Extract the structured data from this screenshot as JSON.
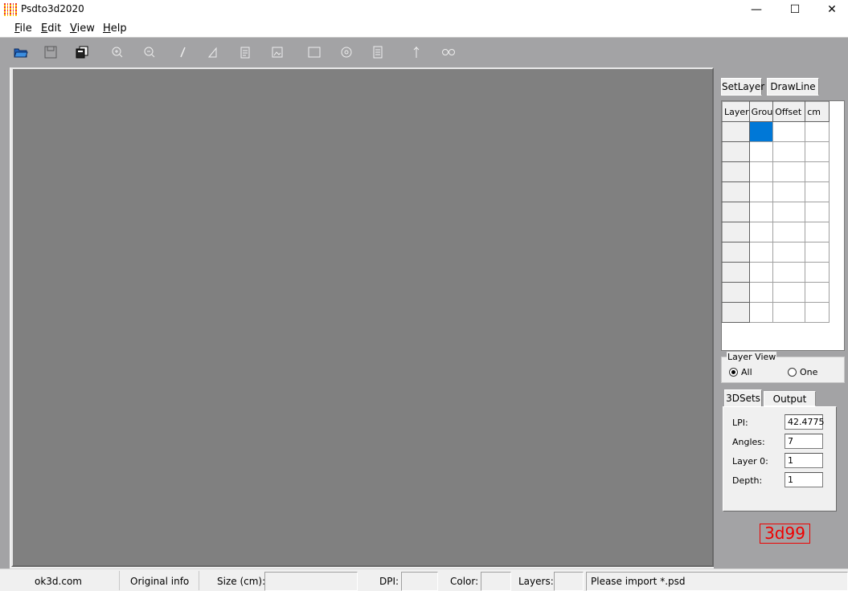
{
  "window": {
    "title": "Psdto3d2020"
  },
  "window_controls": {
    "minimize": "—",
    "maximize": "☐",
    "close": "✕"
  },
  "menu": [
    {
      "label": "File",
      "mnemonic": "F",
      "rest": "ile"
    },
    {
      "label": "Edit",
      "mnemonic": "E",
      "rest": "dit"
    },
    {
      "label": "View",
      "mnemonic": "V",
      "rest": "iew"
    },
    {
      "label": "Help",
      "mnemonic": "H",
      "rest": "elp"
    }
  ],
  "toolbar": [
    {
      "icon": "open-folder-icon"
    },
    {
      "icon": "save-icon"
    },
    {
      "icon": "copy-pages-icon"
    },
    {
      "icon": "zoom-in-icon"
    },
    {
      "icon": "zoom-out-icon"
    },
    {
      "icon": "pen-icon"
    },
    {
      "icon": "triangle-tool-icon"
    },
    {
      "icon": "page-edit-icon"
    },
    {
      "icon": "image-edit-icon"
    },
    {
      "icon": "rectangle-icon"
    },
    {
      "icon": "target-icon"
    },
    {
      "icon": "document-icon"
    },
    {
      "icon": "split-icon"
    },
    {
      "icon": "link-circles-icon"
    }
  ],
  "side_tabs": {
    "set_layer": "SetLayer",
    "draw_line": "DrawLine"
  },
  "layer_grid": {
    "columns": [
      "Layer",
      "Grou",
      "Offset",
      "cm"
    ],
    "row_count": 10,
    "selected_cell": {
      "row": 0,
      "col": 1
    }
  },
  "layer_view": {
    "legend": "Layer View",
    "options": [
      {
        "label": "All",
        "checked": true
      },
      {
        "label": "One",
        "checked": false
      }
    ]
  },
  "sets_tabs": {
    "sets_3d": "3DSets",
    "output_sets": "Output Sets"
  },
  "sets": {
    "lpi_label": "LPI:",
    "lpi_value": "42.4775",
    "angles_label": "Angles:",
    "angles_value": "7",
    "layer0_label": "Layer 0:",
    "layer0_value": "1",
    "depth_label": "Depth:",
    "depth_value": "1"
  },
  "brand_badge": "3d99",
  "status": {
    "website": "ok3d.com",
    "original_info": "Original info",
    "size_label": "Size (cm):",
    "dpi_label": "DPI:",
    "color_label": "Color:",
    "layers_label": "Layers:",
    "message": "Please import *.psd"
  },
  "colors": {
    "selection": "#0078d7",
    "canvas": "#808080",
    "frame": "#a3a3a5",
    "brand_red": "#e00000"
  }
}
